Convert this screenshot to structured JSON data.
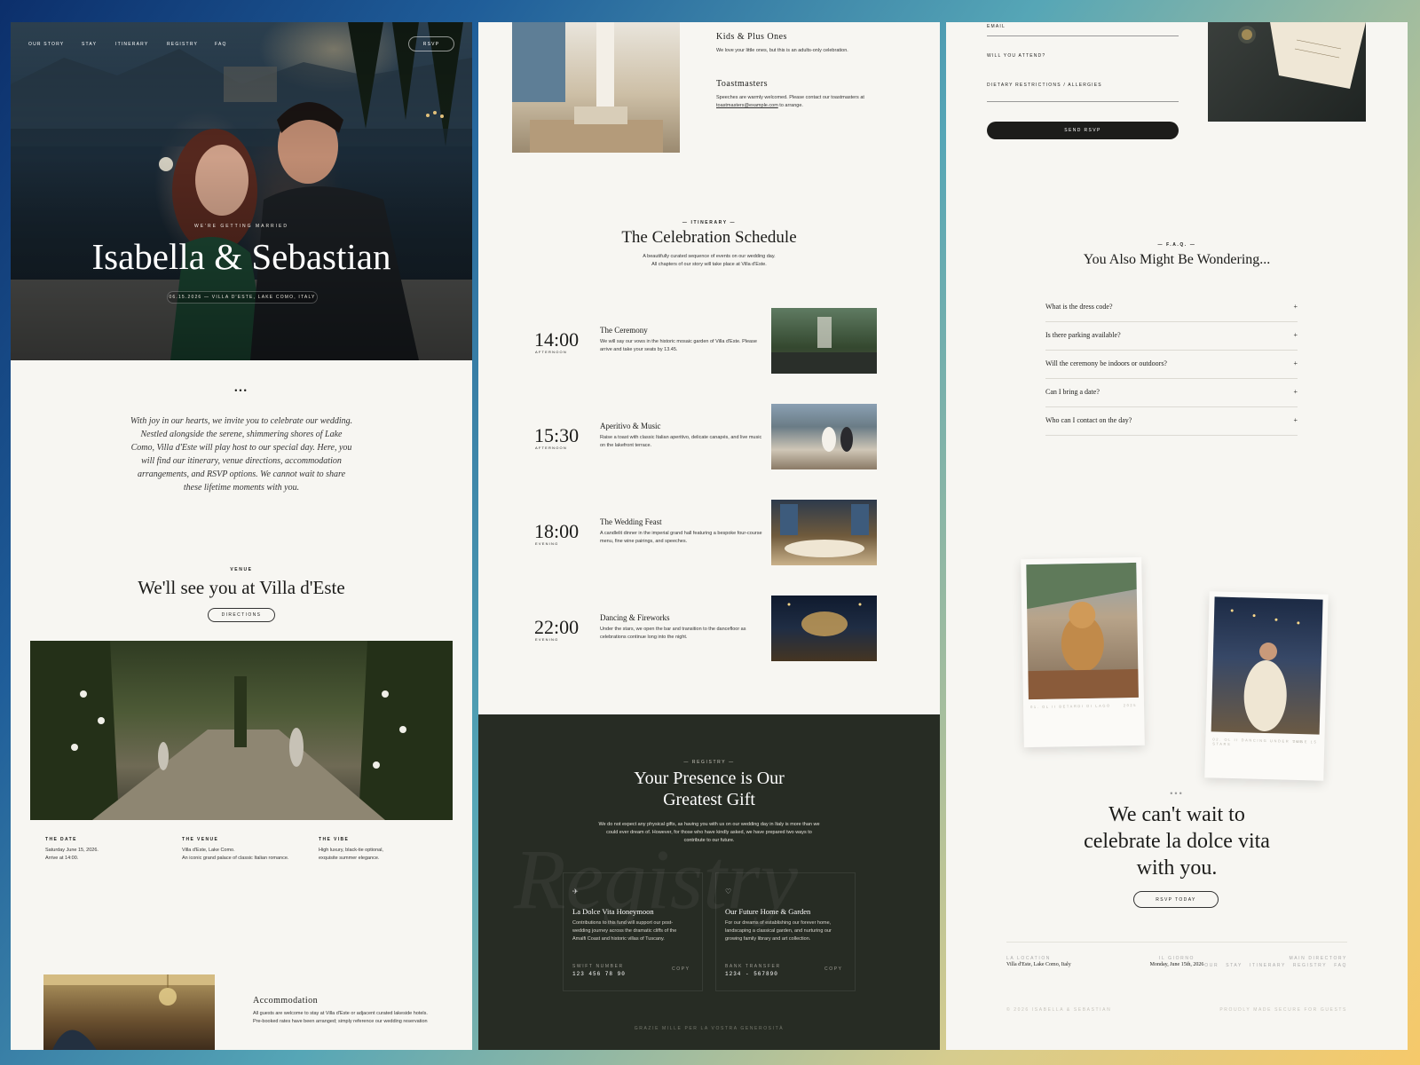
{
  "nav": {
    "items": [
      "OUR STORY",
      "STAY",
      "ITINERARY",
      "REGISTRY",
      "FAQ"
    ],
    "rsvp": "RSVP"
  },
  "hero": {
    "pre": "WE'RE GETTING MARRIED",
    "title": "Isabella & Sebastian",
    "date": "06.15.2026 — VILLA D'ESTE, LAKE COMO, ITALY"
  },
  "intro": {
    "dots": "•••",
    "text": "With joy in our hearts, we invite you to celebrate our wedding. Nestled alongside the serene, shimmering shores of Lake Como, Villa d'Este will play host to our special day. Here, you will find our itinerary, venue directions, accommodation arrangements, and RSVP options. We cannot wait to share these lifetime moments with you."
  },
  "venue": {
    "eyebrow": "VENUE",
    "title": "We'll see you at Villa d'Este",
    "button": "DIRECTIONS",
    "details": [
      {
        "label": "THE DATE",
        "line1": "Saturday June 15, 2026.",
        "line2": "Arrive at 14:00."
      },
      {
        "label": "THE VENUE",
        "line1": "Villa d'Este, Lake Como.",
        "line2": "An iconic grand palace of classic Italian romance."
      },
      {
        "label": "THE VIBE",
        "line1": "High luxury, black-tie optional,",
        "line2": "exquisite summer elegance."
      }
    ]
  },
  "accommodation": {
    "title": "Accommodation",
    "line1": "All guests are welcome to stay at Villa d'Este or adjacent curated lakeside hotels.",
    "line2": "Pre-booked rates have been arranged; simply reference our wedding reservation"
  },
  "info": [
    {
      "title": "Kids & Plus Ones",
      "text": "We love your little ones, but this is an adults-only celebration."
    },
    {
      "title": "Toastmasters",
      "text1": "Speeches are warmly welcomed. Please contact our toastmasters at",
      "link": "toastmasters@example.com",
      "text2": " to arrange."
    }
  ],
  "itinerary": {
    "eyebrow": "— ITINERARY —",
    "title": "The Celebration Schedule",
    "sub1": "A beautifully curated sequence of events on our wedding day.",
    "sub2": "All chapters of our story will take place at Villa d'Este.",
    "events": [
      {
        "time": "14:00",
        "period": "AFTERNOON",
        "title": "The Ceremony",
        "desc": "We will say our vows in the historic mosaic garden of Villa d'Este. Please arrive and take your seats by 13.45."
      },
      {
        "time": "15:30",
        "period": "AFTERNOON",
        "title": "Aperitivo & Music",
        "desc": "Raise a toast with classic Italian aperitivo, delicate canapés, and live music on the lakefront terrace."
      },
      {
        "time": "18:00",
        "period": "EVENING",
        "title": "The Wedding Feast",
        "desc": "A candlelit dinner in the imperial grand hall featuring a bespoke four-course menu, fine wine pairings, and speeches."
      },
      {
        "time": "22:00",
        "period": "EVENING",
        "title": "Dancing & Fireworks",
        "desc": "Under the stars, we open the bar and transition to the dancefloor as celebrations continue long into the night."
      }
    ]
  },
  "registry": {
    "eyebrow": "— REGISTRY —",
    "title1": "Your Presence is Our",
    "title2": "Greatest Gift",
    "text": "We do not expect any physical gifts, as having you with us on our wedding day in Italy is more than we could ever dream of. However, for those who have kindly asked, we have prepared two ways to contribute to our future.",
    "watermark": "Registry",
    "cards": [
      {
        "title": "La Dolce Vita Honeymoon",
        "text": "Contributions to this fund will support our post-wedding journey across the dramatic cliffs of the Amalfi Coast and historic villas of Tuscany.",
        "label": "SWIFT NUMBER",
        "value": "123 456 78 90",
        "copy": "COPY"
      },
      {
        "title": "Our Future Home & Garden",
        "text": "For our dreams of establishing our forever home, landscaping a classical garden, and nurturing our growing family library and art collection.",
        "label": "BANK TRANSFER",
        "value": "1234 - 567890",
        "copy": "COPY"
      }
    ],
    "footer": "GRAZIE MILLE PER LA VOSTRA GENEROSITÀ"
  },
  "rsvp_form": {
    "email": "EMAIL",
    "attend": "WILL YOU ATTEND?",
    "diet": "DIETARY RESTRICTIONS / ALLERGIES",
    "button": "SEND RSVP"
  },
  "faq": {
    "eyebrow": "— F.A.Q. —",
    "title": "You Also Might Be Wondering...",
    "questions": [
      "What is the dress code?",
      "Is there parking available?",
      "Will the ceremony be indoors or outdoors?",
      "Can I bring a date?",
      "Who can I contact on the day?"
    ]
  },
  "photos": [
    {
      "caption": "01. OL II BETARDI DI LAGO",
      "right": "2025"
    },
    {
      "caption": "02. OL II DANCING UNDER THE STARS",
      "right": "JUNE 15"
    }
  ],
  "closing": {
    "dots": "•••",
    "line1": "We can't wait to",
    "line2": "celebrate la dolce vita",
    "line3": "with you.",
    "button": "RSVP TODAY"
  },
  "footer": {
    "loc_label": "LA LOCATION",
    "loc": "Villa d'Este, Lake Como, Italy",
    "day_label": "IL GIORNO",
    "day": "Monday, June 15th, 2026",
    "dir_label": "MAIN DIRECTORY",
    "links": [
      "OUR",
      "STAY",
      "ITINERARY",
      "REGISTRY",
      "FAQ"
    ],
    "copyright": "© 2026 ISABELLA & SEBASTIAN",
    "made": "PROUDLY MADE SECURE FOR GUESTS"
  }
}
